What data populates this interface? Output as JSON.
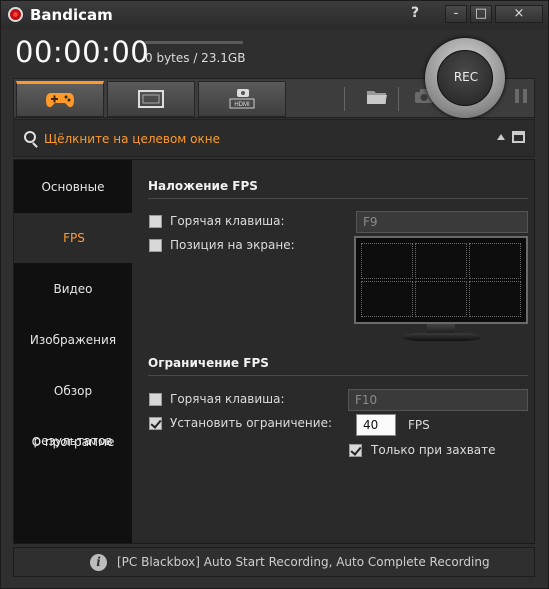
{
  "app": {
    "title": "Bandicam"
  },
  "window_controls": {
    "help": "?",
    "minimize": "-",
    "maximize": "□",
    "close": "×"
  },
  "recorder": {
    "timer": "00:00:00",
    "size_text": "0 bytes / 23.1GB",
    "rec_label": "REC"
  },
  "toolbar": {
    "tabs": [
      {
        "icon": "gamepad-icon"
      },
      {
        "icon": "screen-rect-icon"
      },
      {
        "icon": "hdmi-icon",
        "label": "HDMI"
      }
    ],
    "right_icons": [
      "folder-icon",
      "camera-icon",
      "pause-icon"
    ]
  },
  "target": {
    "text": "Щёлкните на целевом окне"
  },
  "sidebar": {
    "items": [
      {
        "label": "Основные"
      },
      {
        "label": "FPS"
      },
      {
        "label": "Видео"
      },
      {
        "label": "Изображения"
      },
      {
        "label": "Обзор результатов"
      },
      {
        "label": "О программе"
      }
    ],
    "active_index": 1
  },
  "fps_overlay": {
    "title": "Наложение FPS",
    "hotkey_label": "Горячая клавиша:",
    "hotkey_value": "F9",
    "hotkey_checked": false,
    "position_label": "Позиция на экране:",
    "position_checked": false
  },
  "fps_limit": {
    "title": "Ограничение FPS",
    "hotkey_label": "Горячая клавиша:",
    "hotkey_value": "F10",
    "hotkey_checked": false,
    "limit_label": "Установить ограничение:",
    "limit_checked": true,
    "limit_value": "40",
    "limit_unit": "FPS",
    "capture_only_label": "Только при захвате",
    "capture_only_checked": true
  },
  "status": {
    "text": "[PC Blackbox] Auto Start Recording, Auto Complete Recording"
  },
  "colors": {
    "accent": "#ff9a2a",
    "rec_red": "#cc1111"
  }
}
